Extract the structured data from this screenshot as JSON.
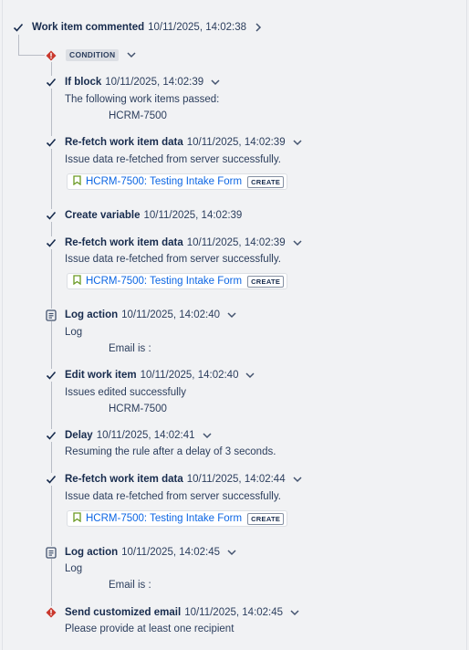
{
  "root": {
    "title": "Work item commented",
    "timestamp": "10/11/2025, 14:02:38"
  },
  "condition": {
    "label": "CONDITION"
  },
  "steps": [
    {
      "title": "If block",
      "timestamp": "10/11/2025, 14:02:39",
      "message": "The following work items passed:",
      "detail": "HCRM-7500"
    },
    {
      "title": "Re-fetch work item data",
      "timestamp": "10/11/2025, 14:02:39",
      "message": "Issue data re-fetched from server successfully.",
      "card": {
        "link": "HCRM-7500: Testing Intake Form",
        "tag": "CREATE"
      }
    },
    {
      "title": "Create variable",
      "timestamp": "10/11/2025, 14:02:39"
    },
    {
      "title": "Re-fetch work item data",
      "timestamp": "10/11/2025, 14:02:39",
      "message": "Issue data re-fetched from server successfully.",
      "card": {
        "link": "HCRM-7500: Testing Intake Form",
        "tag": "CREATE"
      }
    },
    {
      "title": "Log action",
      "timestamp": "10/11/2025, 14:02:40",
      "message": "Log",
      "detail": "Email is :"
    },
    {
      "title": "Edit work item",
      "timestamp": "10/11/2025, 14:02:40",
      "message": "Issues edited successfully",
      "detail": "HCRM-7500"
    },
    {
      "title": "Delay",
      "timestamp": "10/11/2025, 14:02:41",
      "message": "Resuming the rule after a delay of 3 seconds."
    },
    {
      "title": "Re-fetch work item data",
      "timestamp": "10/11/2025, 14:02:44",
      "message": "Issue data re-fetched from server successfully.",
      "card": {
        "link": "HCRM-7500: Testing Intake Form",
        "tag": "CREATE"
      }
    },
    {
      "title": "Log action",
      "timestamp": "10/11/2025, 14:02:45",
      "message": "Log",
      "detail": "Email is :"
    },
    {
      "title": "Send customized email",
      "timestamp": "10/11/2025, 14:02:45",
      "message": "Please provide at least one recipient"
    }
  ],
  "colors": {
    "success": "#172b4d",
    "error": "#c9372c",
    "link": "#0c66e4",
    "line": "#b9bdc6"
  },
  "icons": {
    "success": "check-icon",
    "error": "error-icon",
    "log": "log-icon",
    "issue": "bookmark-icon",
    "expand": "chevron-down-icon",
    "navigate": "chevron-right-icon"
  }
}
